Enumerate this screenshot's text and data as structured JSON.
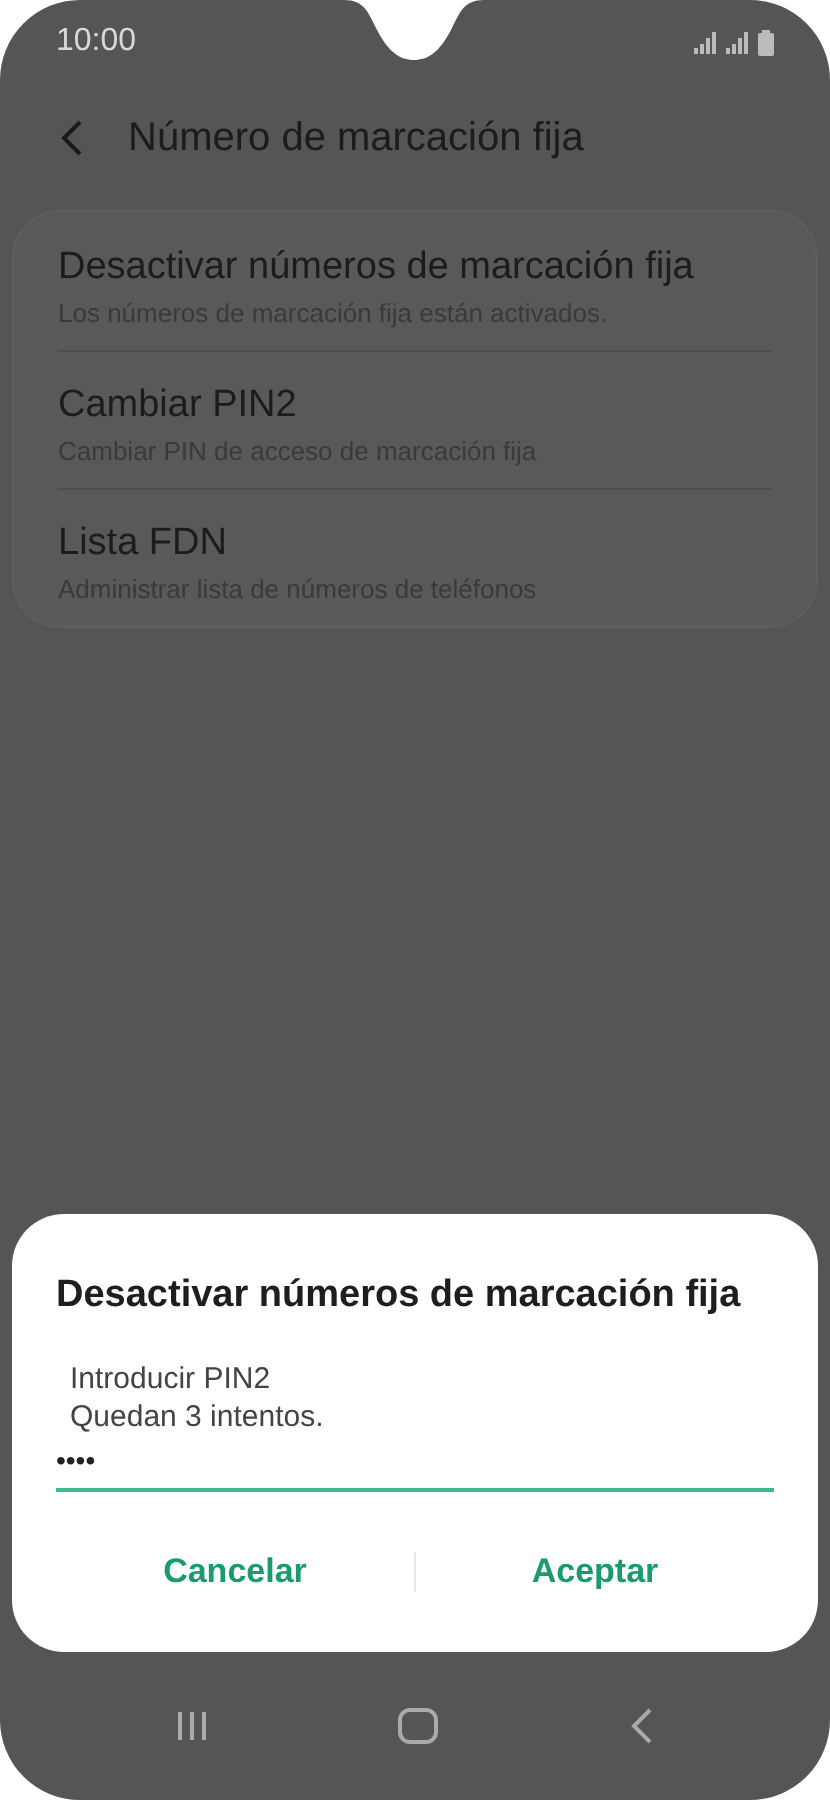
{
  "status_bar": {
    "time": "10:00"
  },
  "header": {
    "title": "Número de marcación fija"
  },
  "settings": [
    {
      "title": "Desactivar números de marcación fija",
      "subtitle": "Los números de marcación fija están activados."
    },
    {
      "title": "Cambiar PIN2",
      "subtitle": "Cambiar PIN de acceso de marcación fija"
    },
    {
      "title": "Lista FDN",
      "subtitle": "Administrar lista de números de teléfonos"
    }
  ],
  "dialog": {
    "title": "Desactivar números de marcación fija",
    "label": "Introducir PIN2",
    "hint": "Quedan 3 intentos.",
    "value": "••••",
    "buttons": [
      "Cancelar",
      "Aceptar"
    ]
  }
}
